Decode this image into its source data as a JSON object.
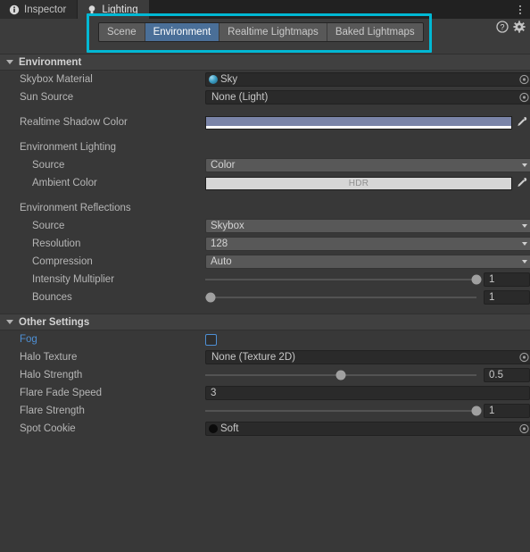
{
  "window": {
    "tabs": [
      {
        "label": "Inspector",
        "icon": "info-icon",
        "active": false
      },
      {
        "label": "Lighting",
        "icon": "lightbulb-icon",
        "active": true
      }
    ],
    "menu_icon": "kebab-menu-icon",
    "help_icon": "help-icon",
    "settings_icon": "gear-icon",
    "highlight_color": "#00b8d4"
  },
  "mode_tabs": {
    "items": [
      {
        "label": "Scene",
        "active": false
      },
      {
        "label": "Environment",
        "active": true
      },
      {
        "label": "Realtime Lightmaps",
        "active": false
      },
      {
        "label": "Baked Lightmaps",
        "active": false
      }
    ],
    "active_color": "#4a6f98"
  },
  "environment": {
    "header": "Environment",
    "skybox_material": {
      "label": "Skybox Material",
      "value": "Sky",
      "icon": "material-sphere-icon",
      "picker": "object-picker-icon"
    },
    "sun_source": {
      "label": "Sun Source",
      "value": "None (Light)",
      "picker": "object-picker-icon"
    },
    "realtime_shadow_color": {
      "label": "Realtime Shadow Color",
      "color": "#7a84a8",
      "alpha_color": "#ffffff",
      "eyedropper": "eyedropper-icon"
    },
    "lighting_group": "Environment Lighting",
    "lighting_source": {
      "label": "Source",
      "value": "Color"
    },
    "ambient_color": {
      "label": "Ambient Color",
      "color": "#d6d6d6",
      "badge": "HDR",
      "eyedropper": "eyedropper-icon"
    },
    "reflections_group": "Environment Reflections",
    "reflections_source": {
      "label": "Source",
      "value": "Skybox"
    },
    "resolution": {
      "label": "Resolution",
      "value": "128"
    },
    "compression": {
      "label": "Compression",
      "value": "Auto"
    },
    "intensity_multiplier": {
      "label": "Intensity Multiplier",
      "value": "1",
      "slider_pct": 100
    },
    "bounces": {
      "label": "Bounces",
      "value": "1",
      "slider_pct": 2
    }
  },
  "other_settings": {
    "header": "Other Settings",
    "fog": {
      "label": "Fog",
      "checked": false
    },
    "halo_texture": {
      "label": "Halo Texture",
      "value": "None (Texture 2D)",
      "picker": "object-picker-icon"
    },
    "halo_strength": {
      "label": "Halo Strength",
      "value": "0.5",
      "slider_pct": 50
    },
    "flare_fade_speed": {
      "label": "Flare Fade Speed",
      "value": "3"
    },
    "flare_strength": {
      "label": "Flare Strength",
      "value": "1",
      "slider_pct": 100
    },
    "spot_cookie": {
      "label": "Spot Cookie",
      "value": "Soft",
      "icon": "texture-preview-icon",
      "picker": "object-picker-icon"
    }
  }
}
